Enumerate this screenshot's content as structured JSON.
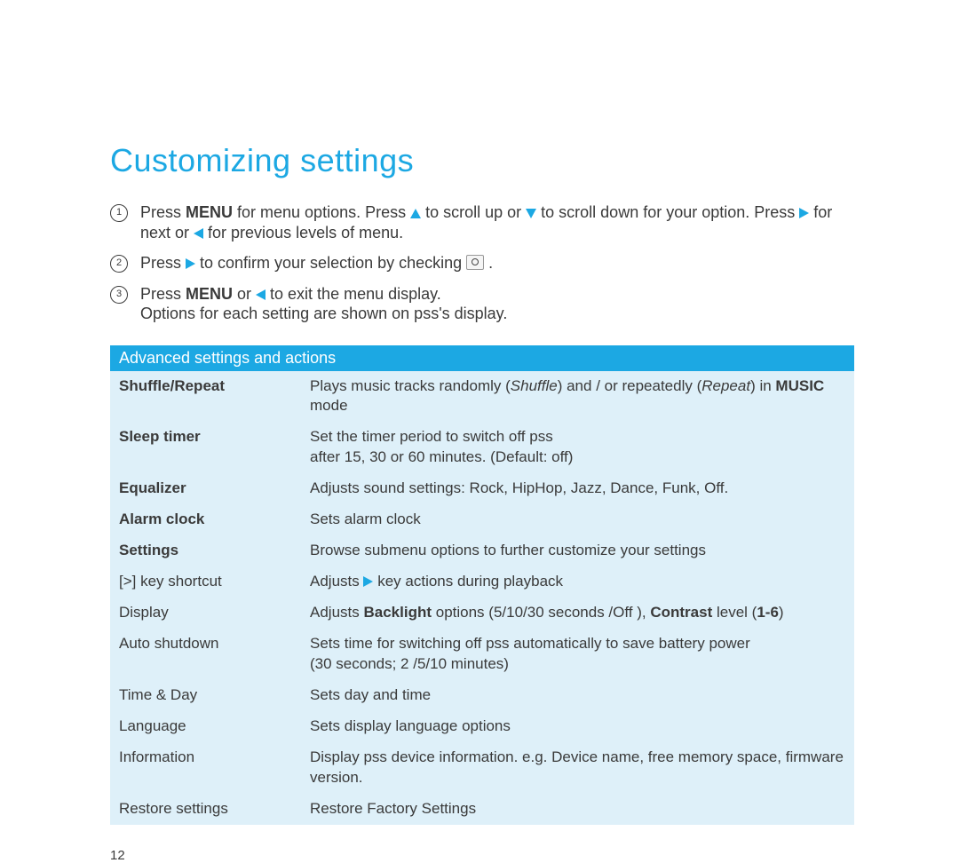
{
  "title": "Customizing settings",
  "page_number": "12",
  "steps": {
    "s1a": "Press ",
    "s1b": "MENU",
    "s1c": " for menu options. Press ",
    "s1d": " to scroll up or ",
    "s1e": " to scroll down for your option. Press ",
    "s1f": " for next or ",
    "s1g": " for previous levels of menu.",
    "s2a": "Press ",
    "s2b": " to confirm your selection by checking ",
    "s2c": " .",
    "s3a": "Press ",
    "s3b": "MENU",
    "s3c": "  or ",
    "s3d": " to exit the menu display.",
    "s3e": "Options for each setting are shown on pss's display."
  },
  "table": {
    "header": "Advanced settings and actions",
    "rows": [
      {
        "label": "Shuffle/Repeat",
        "label_bold": true,
        "desc_parts": [
          {
            "t": "Plays music tracks randomly ("
          },
          {
            "t": "Shuffle",
            "i": true
          },
          {
            "t": ") and / or repeatedly ("
          },
          {
            "t": "Repeat",
            "i": true
          },
          {
            "t": ") in "
          },
          {
            "t": "MUSIC",
            "b": true
          },
          {
            "t": " mode"
          }
        ]
      },
      {
        "label": "Sleep timer",
        "label_bold": true,
        "desc_parts": [
          {
            "t": "Set the timer period to switch off pss"
          },
          {
            "br": true
          },
          {
            "t": "after 15, 30 or 60 minutes.  (Default: off)"
          }
        ]
      },
      {
        "label": "Equalizer",
        "label_bold": true,
        "desc_parts": [
          {
            "t": "Adjusts sound settings: Rock, HipHop, Jazz, Dance, Funk, Off."
          }
        ]
      },
      {
        "label": "Alarm clock",
        "label_bold": true,
        "desc_parts": [
          {
            "t": "Sets alarm clock"
          }
        ]
      },
      {
        "label": "Settings",
        "label_bold": true,
        "desc_parts": [
          {
            "t": "Browse submenu options to further customize your settings"
          }
        ]
      },
      {
        "label": "[>] key shortcut",
        "desc_parts": [
          {
            "t": "Adjusts "
          },
          {
            "icon": "tri-right"
          },
          {
            "t": " key actions during playback"
          }
        ]
      },
      {
        "label": "Display",
        "desc_parts": [
          {
            "t": "Adjusts "
          },
          {
            "t": "Backlight",
            "b": true
          },
          {
            "t": " options (5/10/30 seconds /Off ), "
          },
          {
            "t": "Contrast",
            "b": true
          },
          {
            "t": " level ("
          },
          {
            "t": "1-6",
            "b": true
          },
          {
            "t": ")"
          }
        ]
      },
      {
        "label": "Auto shutdown",
        "desc_parts": [
          {
            "t": "Sets time for switching off pss automatically to save battery power"
          },
          {
            "br": true
          },
          {
            "t": "(30 seconds; 2 /5/10 minutes)"
          }
        ]
      },
      {
        "label": "Time & Day",
        "desc_parts": [
          {
            "t": "Sets day and time"
          }
        ]
      },
      {
        "label": "Language",
        "desc_parts": [
          {
            "t": "Sets display language options"
          }
        ]
      },
      {
        "label": "Information",
        "desc_parts": [
          {
            "t": "Display pss device information. e.g. Device name, free memory space, firmware version."
          }
        ]
      },
      {
        "label": "Restore settings",
        "desc_parts": [
          {
            "t": "Restore Factory Settings"
          }
        ]
      }
    ]
  }
}
